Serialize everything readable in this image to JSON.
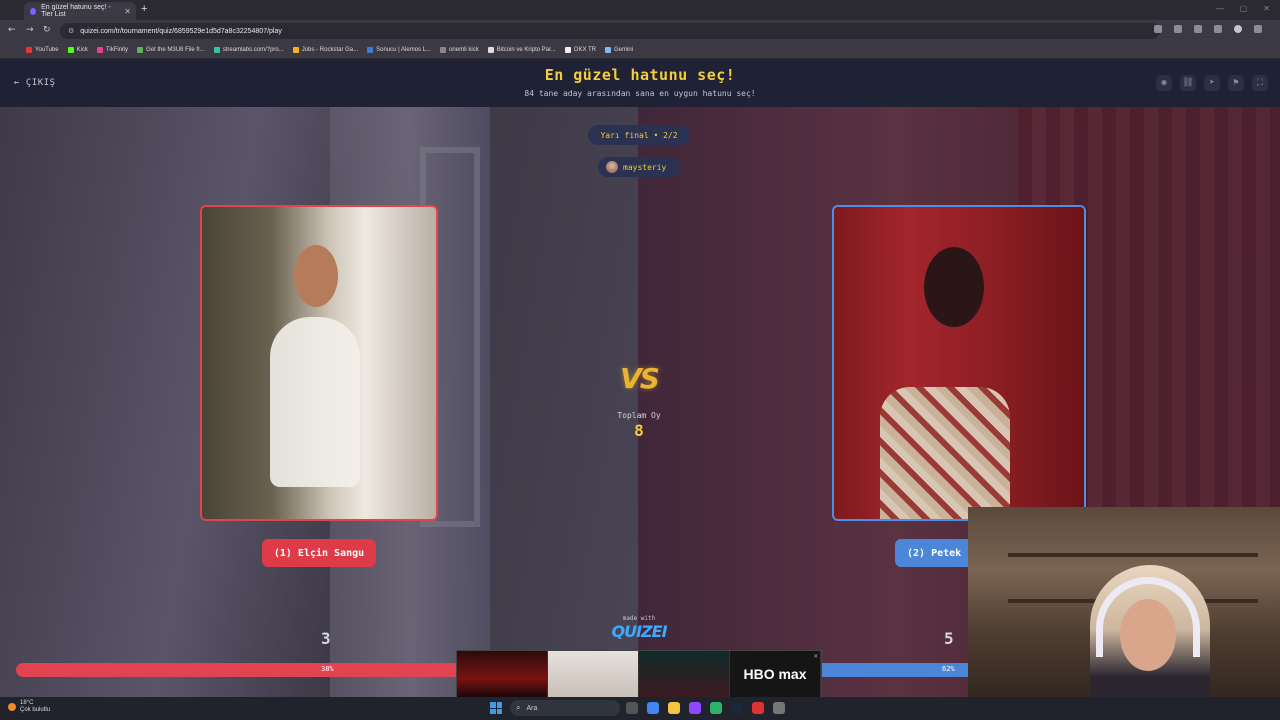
{
  "browser": {
    "tab_title": "En güzel hatunu seç! - Tier List",
    "url": "quizei.com/tr/tournament/quiz/6859529e1d5d7a8c32254807/play",
    "bookmarks": [
      "YouTube",
      "Kick",
      "TikFinity",
      "Get the M3U8 File fr...",
      "streamlabs.com/?pro...",
      "Jobs - Rockstar Ga...",
      "Sonucu | Alemos L...",
      "onemli kick",
      "Bitcoin ve Kripto Par...",
      "OKX TR",
      "Gemini"
    ]
  },
  "header": {
    "exit_label": "ÇIKIŞ",
    "title": "En güzel hatunu seç!",
    "subtitle": "84 tane aday arasından sana en uygun hatunu seç!"
  },
  "match": {
    "round_label": "Yarı final • 2/2",
    "creator": "maysteriy",
    "vs_label": "VS",
    "total_votes_label": "Toplam Oy",
    "total_votes": "8",
    "left": {
      "name": "(1) Elçin Sangu",
      "votes": "3",
      "percent_label": "38%",
      "percent": 38,
      "color": "#e24350"
    },
    "right": {
      "name": "(2) Petek",
      "votes": "5",
      "percent_label": "62%",
      "percent": 62,
      "color": "#4c86d8"
    }
  },
  "branding": {
    "made_with": "made with",
    "logo": "QUIZEI"
  },
  "taskbar_preview": {
    "last_label": "HBO max"
  },
  "taskbar": {
    "weather_temp": "18°C",
    "weather_desc": "Çok bulutlu",
    "search_placeholder": "Ara"
  }
}
